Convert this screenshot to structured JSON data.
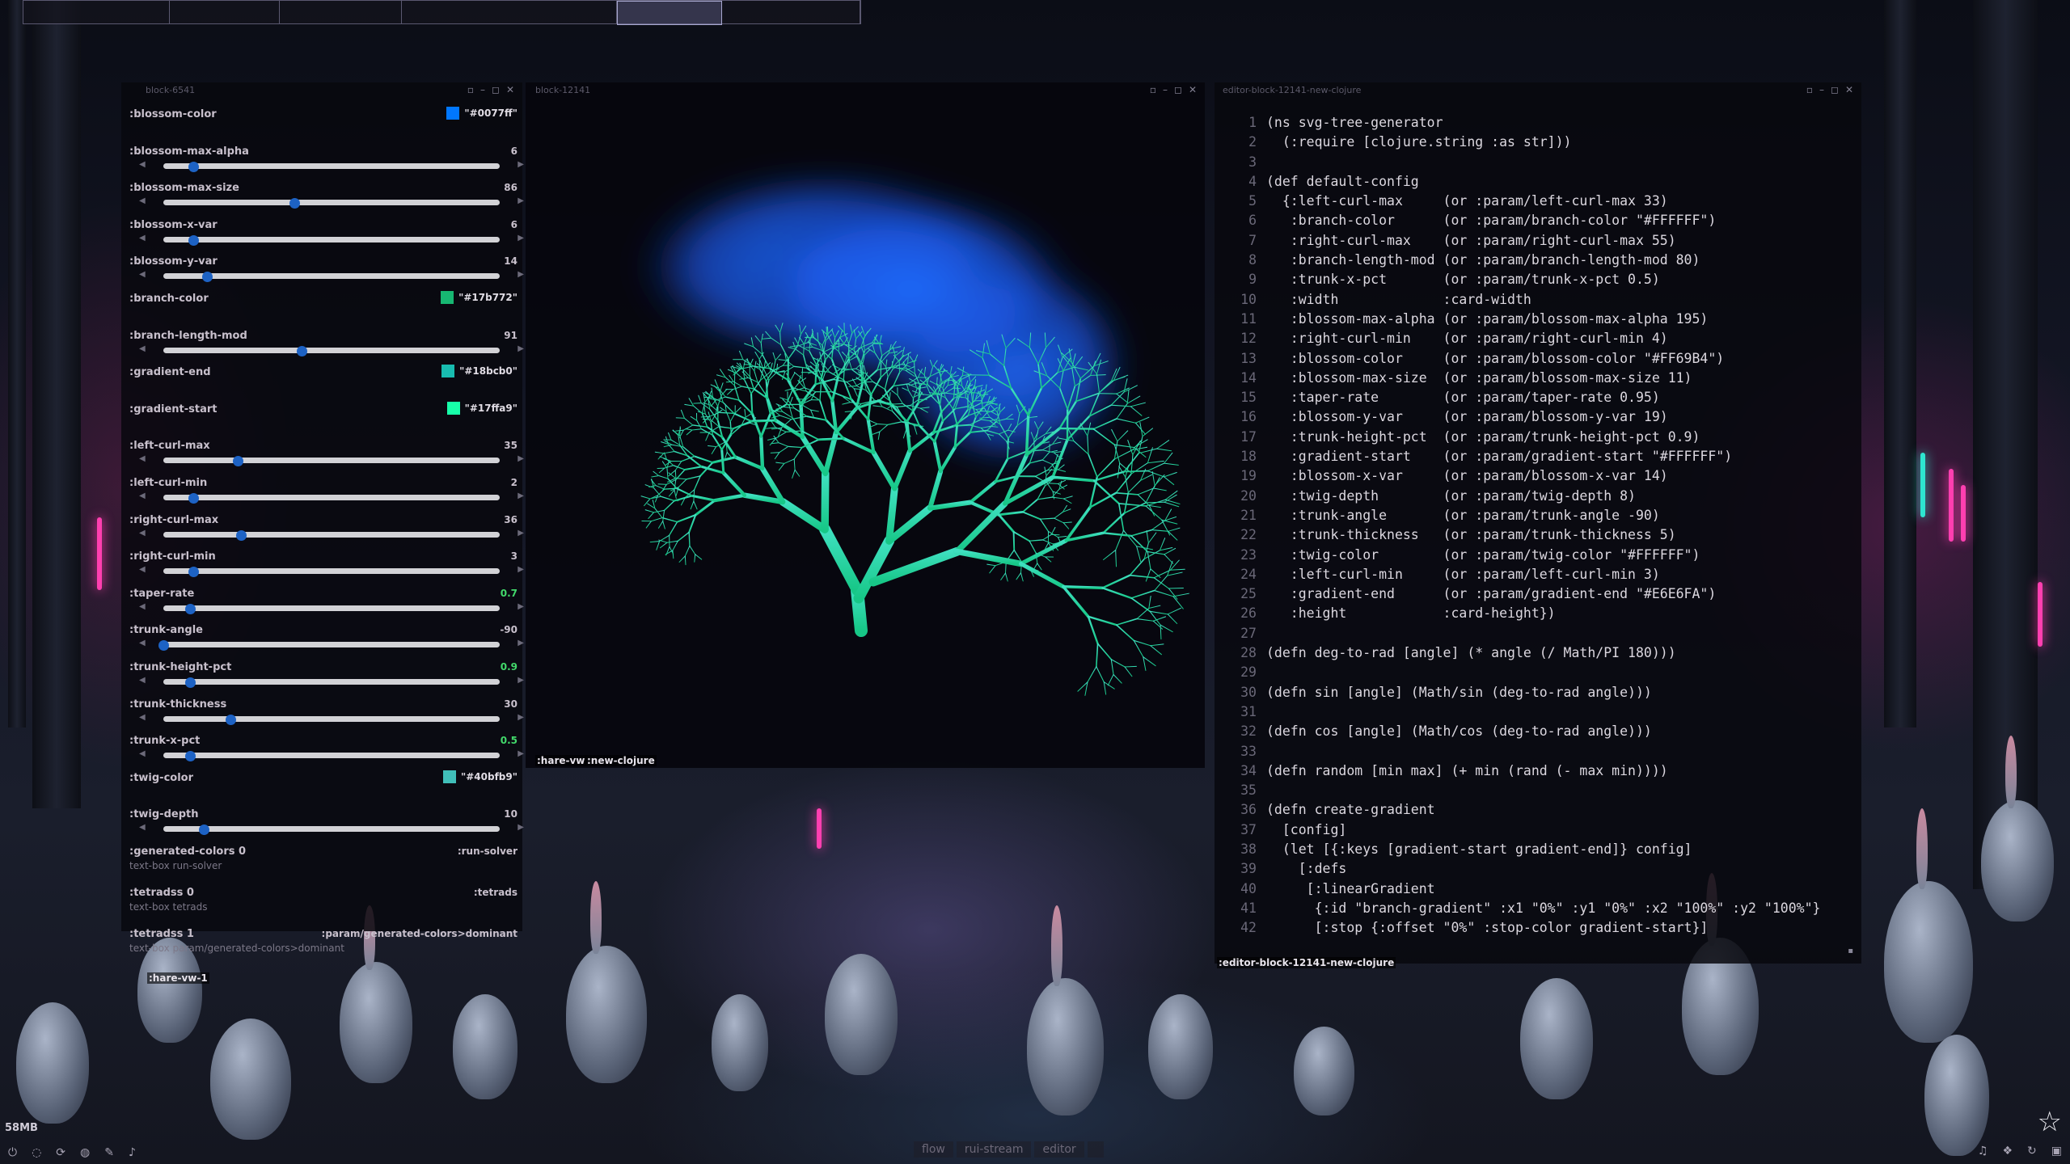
{
  "workspaces": [
    "",
    "",
    "",
    "",
    "",
    ""
  ],
  "param_panel": {
    "title": "block-6541",
    "rows": [
      {
        "label": ":blossom-color",
        "kind": "color",
        "color": "#0077ff",
        "value": "\"#0077ff\""
      },
      {
        "label": ":blossom-max-alpha",
        "kind": "slider",
        "value": "6",
        "fraction": 0.09
      },
      {
        "label": ":blossom-max-size",
        "kind": "slider",
        "value": "86",
        "fraction": 0.39
      },
      {
        "label": ":blossom-x-var",
        "kind": "slider",
        "value": "6",
        "fraction": 0.09
      },
      {
        "label": ":blossom-y-var",
        "kind": "slider",
        "value": "14",
        "fraction": 0.13
      },
      {
        "label": ":branch-color",
        "kind": "color",
        "color": "#17b772",
        "value": "\"#17b772\""
      },
      {
        "label": ":branch-length-mod",
        "kind": "slider",
        "value": "91",
        "fraction": 0.41
      },
      {
        "label": ":gradient-end",
        "kind": "color",
        "color": "#18bcb0",
        "value": "\"#18bcb0\""
      },
      {
        "label": ":gradient-start",
        "kind": "color",
        "color": "#17ffa9",
        "value": "\"#17ffa9\""
      },
      {
        "label": ":left-curl-max",
        "kind": "slider",
        "value": "35",
        "fraction": 0.22
      },
      {
        "label": ":left-curl-min",
        "kind": "slider",
        "value": "2",
        "fraction": 0.09
      },
      {
        "label": ":right-curl-max",
        "kind": "slider",
        "value": "36",
        "fraction": 0.23
      },
      {
        "label": ":right-curl-min",
        "kind": "slider",
        "value": "3",
        "fraction": 0.09
      },
      {
        "label": ":taper-rate",
        "kind": "slider",
        "value": "0.7",
        "fraction": 0.08,
        "green": true
      },
      {
        "label": ":trunk-angle",
        "kind": "slider",
        "value": "-90",
        "fraction": 0.0
      },
      {
        "label": ":trunk-height-pct",
        "kind": "slider",
        "value": "0.9",
        "fraction": 0.08,
        "green": true
      },
      {
        "label": ":trunk-thickness",
        "kind": "slider",
        "value": "30",
        "fraction": 0.2
      },
      {
        "label": ":trunk-x-pct",
        "kind": "slider",
        "value": "0.5",
        "fraction": 0.08,
        "green": true
      },
      {
        "label": ":twig-color",
        "kind": "color",
        "color": "#40bfb9",
        "value": "\"#40bfb9\""
      },
      {
        "label": ":twig-depth",
        "kind": "slider",
        "value": "10",
        "fraction": 0.12
      }
    ],
    "solvers": [
      {
        "label": ":generated-colors 0",
        "value": ":run-solver",
        "sub": "text-box run-solver"
      },
      {
        "label": ":tetradss 0",
        "value": ":tetrads",
        "sub": "text-box tetrads"
      },
      {
        "label": ":tetradss 1",
        "value": ":param/generated-colors>dominant",
        "sub": "text-box param/generated-colors>dominant"
      }
    ],
    "footer_tag": ":hare-vw-1"
  },
  "canvas_window": {
    "title": "block-12141",
    "tag_a": ":hare-vw",
    "tag_b": ":new-clojure"
  },
  "editor": {
    "title": "editor-block-12141-new-clojure",
    "footer_tag": ":editor-block-12141-new-clojure",
    "lines": [
      "(ns svg-tree-generator",
      "  (:require [clojure.string :as str]))",
      "",
      "(def default-config",
      "  {:left-curl-max     (or :param/left-curl-max 33)",
      "   :branch-color      (or :param/branch-color \"#FFFFFF\")",
      "   :right-curl-max    (or :param/right-curl-max 55)",
      "   :branch-length-mod (or :param/branch-length-mod 80)",
      "   :trunk-x-pct       (or :param/trunk-x-pct 0.5)",
      "   :width             :card-width",
      "   :blossom-max-alpha (or :param/blossom-max-alpha 195)",
      "   :right-curl-min    (or :param/right-curl-min 4)",
      "   :blossom-color     (or :param/blossom-color \"#FF69B4\")",
      "   :blossom-max-size  (or :param/blossom-max-size 11)",
      "   :taper-rate        (or :param/taper-rate 0.95)",
      "   :blossom-y-var     (or :param/blossom-y-var 19)",
      "   :trunk-height-pct  (or :param/trunk-height-pct 0.9)",
      "   :gradient-start    (or :param/gradient-start \"#FFFFFF\")",
      "   :blossom-x-var     (or :param/blossom-x-var 14)",
      "   :twig-depth        (or :param/twig-depth 8)",
      "   :trunk-angle       (or :param/trunk-angle -90)",
      "   :trunk-thickness   (or :param/trunk-thickness 5)",
      "   :twig-color        (or :param/twig-color \"#FFFFFF\")",
      "   :left-curl-min     (or :param/left-curl-min 3)",
      "   :gradient-end      (or :param/gradient-end \"#E6E6FA\")",
      "   :height            :card-height})",
      "",
      "(defn deg-to-rad [angle] (* angle (/ Math/PI 180)))",
      "",
      "(defn sin [angle] (Math/sin (deg-to-rad angle)))",
      "",
      "(defn cos [angle] (Math/cos (deg-to-rad angle)))",
      "",
      "(defn random [min max] (+ min (rand (- max min))))",
      "",
      "(defn create-gradient",
      "  [config]",
      "  (let [{:keys [gradient-start gradient-end]} config]",
      "    [:defs",
      "     [:linearGradient",
      "      {:id \"branch-gradient\" :x1 \"0%\" :y1 \"0%\" :x2 \"100%\" :y2 \"100%\"}",
      "      [:stop {:offset \"0%\" :stop-color gradient-start}]"
    ]
  },
  "status": {
    "memory": "58MB",
    "bottom_tabs": [
      "flow",
      "rui-stream",
      "editor",
      ""
    ]
  },
  "icons": {
    "status_left": [
      "power-icon",
      "eye-off-icon",
      "sync-icon",
      "globe-icon",
      "feather-icon",
      "mic-icon"
    ],
    "tray": [
      "bell-icon",
      "layers-icon",
      "refresh-icon",
      "save-icon"
    ]
  }
}
